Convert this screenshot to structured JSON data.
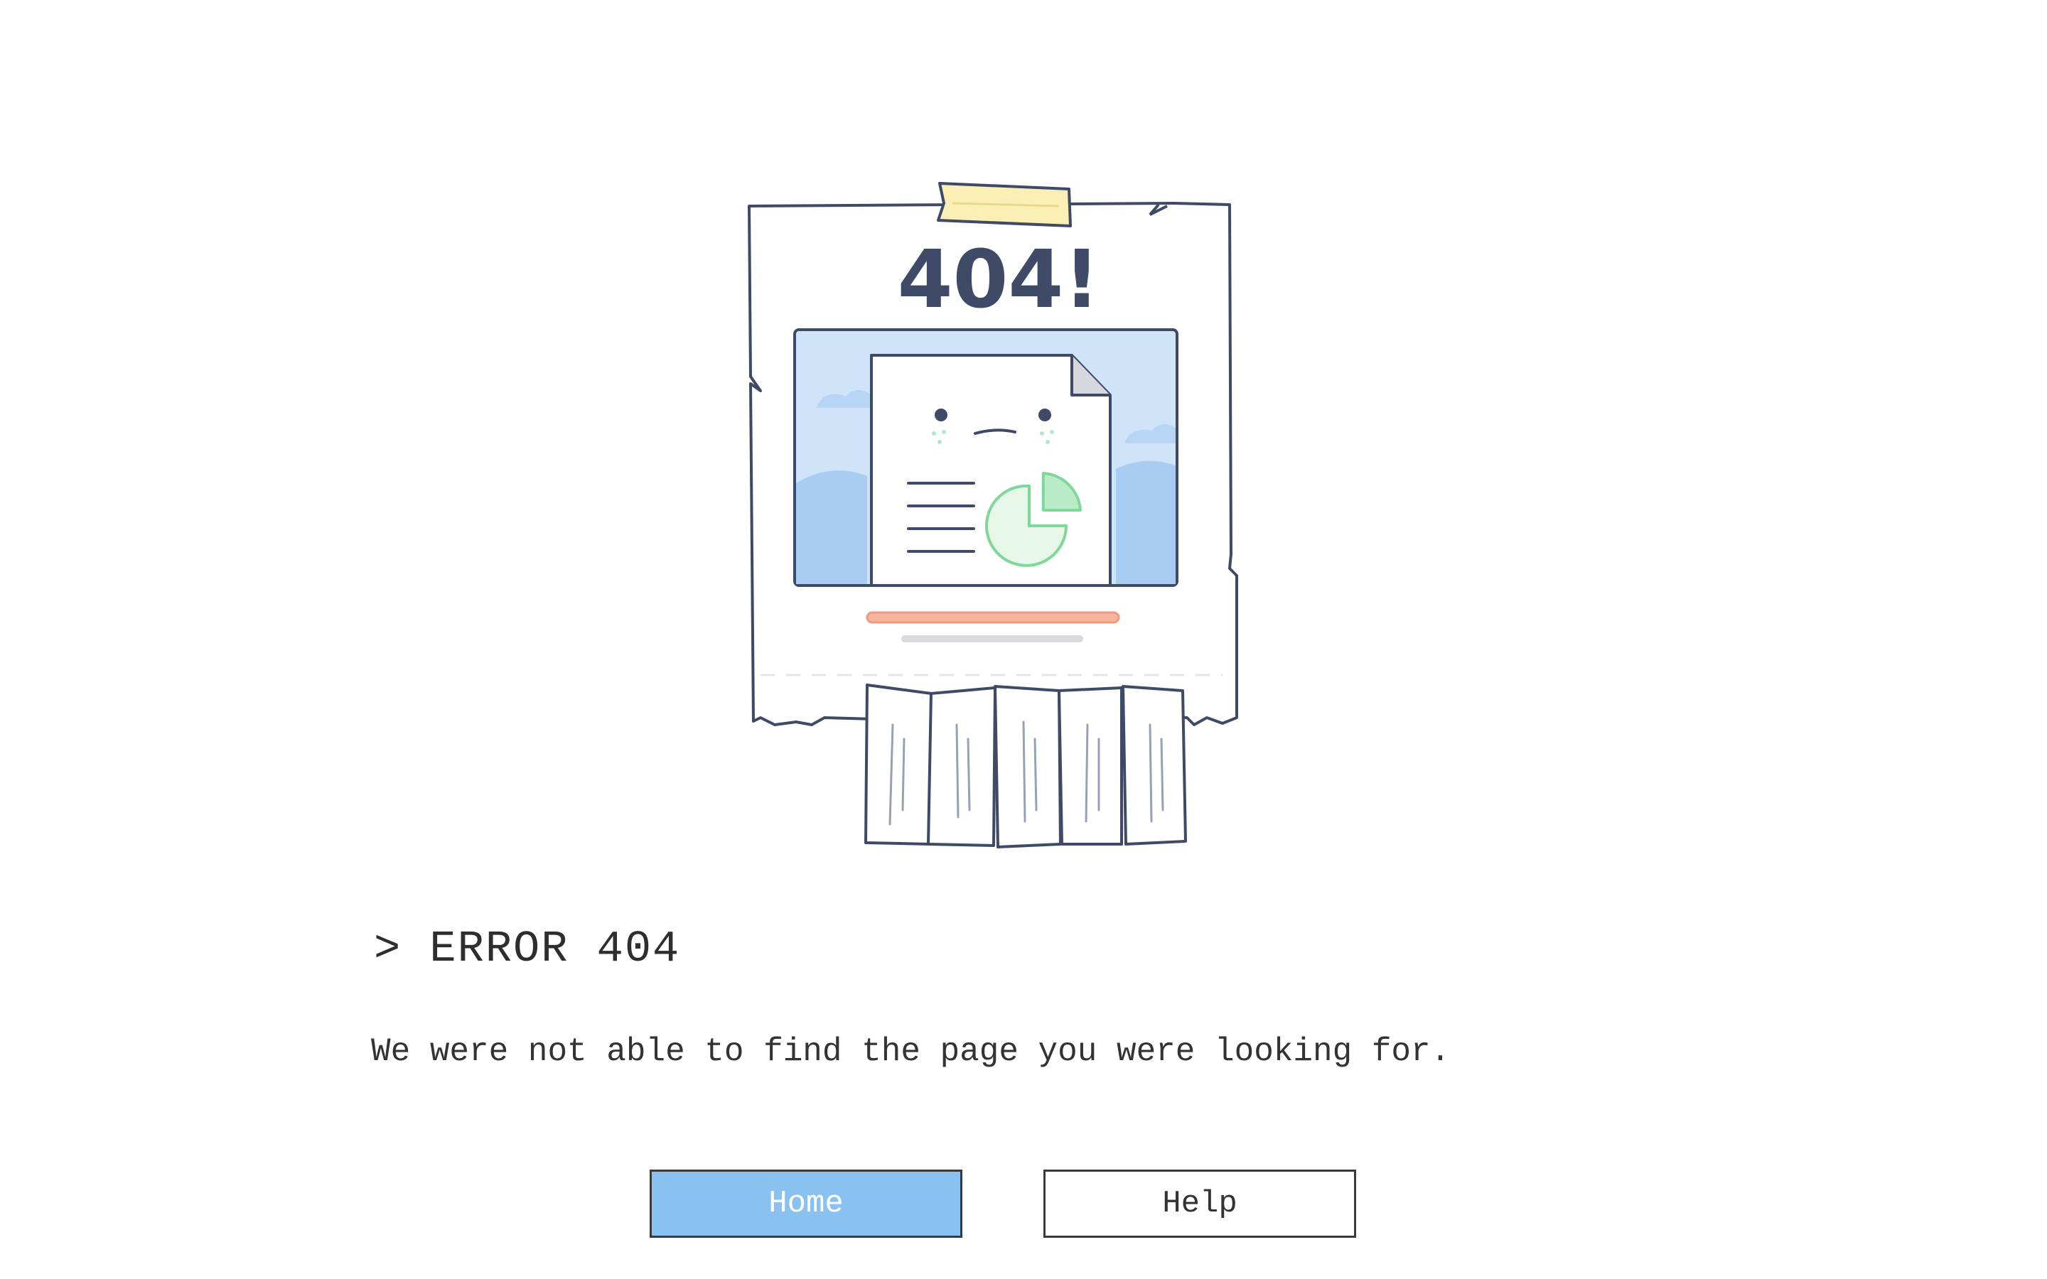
{
  "illustration": {
    "heading": "404!",
    "icon": "shredded-404-notice-illustration"
  },
  "error": {
    "title": "> ERROR 404",
    "message": "We were not able to find the page you were looking for."
  },
  "buttons": {
    "home_label": "Home",
    "help_label": "Help"
  },
  "colors": {
    "home_button_bg": "#89c2f0",
    "ink": "#3f4a66",
    "sky": "#cfe4f8",
    "chart_green": "#7fd79a",
    "tape": "#fbefb6",
    "progress_bar": "#f29a80"
  }
}
